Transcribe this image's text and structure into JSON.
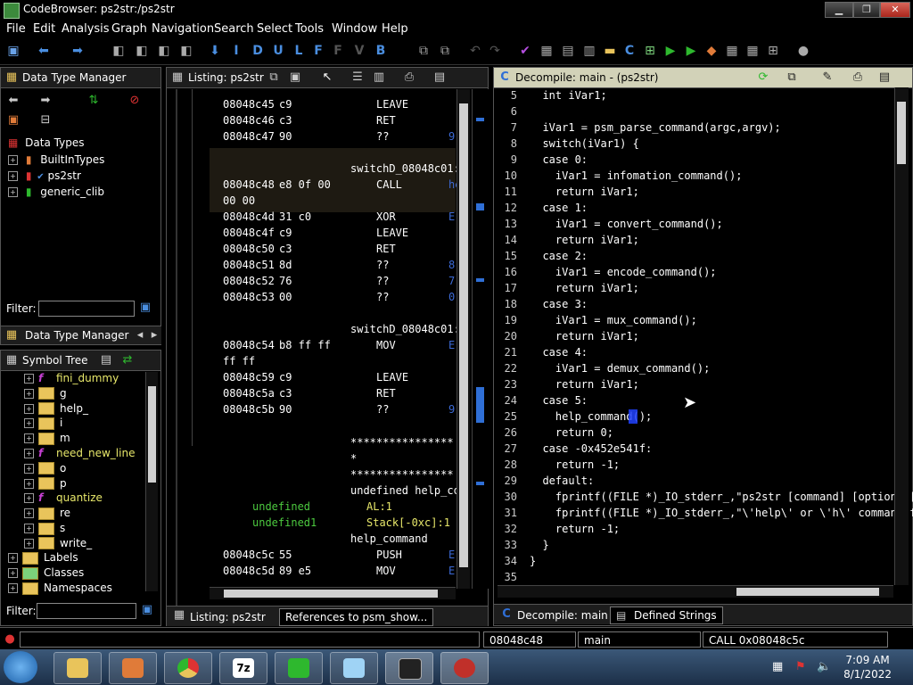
{
  "window": {
    "title": "CodeBrowser: ps2str:/ps2str"
  },
  "menu": [
    "File",
    "Edit",
    "Analysis",
    "Graph",
    "Navigation",
    "Search",
    "Select",
    "Tools",
    "Window",
    "Help"
  ],
  "data_type_manager": {
    "title": "Data Type Manager",
    "root": "Data Types",
    "items": [
      "BuiltInTypes",
      "ps2str",
      "generic_clib"
    ],
    "filter_label": "Filter:",
    "tab": "Data Type Manager"
  },
  "symbol_tree": {
    "title": "Symbol Tree",
    "items": [
      {
        "label": "fini_dummy",
        "kind": "function"
      },
      {
        "label": "g",
        "kind": "folder"
      },
      {
        "label": "help_",
        "kind": "folder"
      },
      {
        "label": "i",
        "kind": "folder"
      },
      {
        "label": "m",
        "kind": "folder"
      },
      {
        "label": "need_new_line",
        "kind": "function"
      },
      {
        "label": "o",
        "kind": "folder"
      },
      {
        "label": "p",
        "kind": "folder"
      },
      {
        "label": "quantize",
        "kind": "function"
      },
      {
        "label": "re",
        "kind": "folder"
      },
      {
        "label": "s",
        "kind": "folder"
      },
      {
        "label": "write_",
        "kind": "folder"
      }
    ],
    "roots": [
      "Labels",
      "Classes",
      "Namespaces"
    ],
    "filter_label": "Filter:"
  },
  "listing": {
    "title": "Listing:  ps2str",
    "lines": [
      {
        "addr": "08048c45",
        "bytes": "c9",
        "mnem": "LEAVE",
        "op": ""
      },
      {
        "addr": "08048c46",
        "bytes": "c3",
        "mnem": "RET",
        "op": ""
      },
      {
        "addr": "08048c47",
        "bytes": "90",
        "mnem": "??",
        "op": "9"
      },
      {
        "label": "switchD_08048c01:"
      },
      {
        "addr": "08048c48",
        "bytes": "e8 0f 00",
        "mnem": "CALL",
        "op": "he"
      },
      {
        "cont": "00 00"
      },
      {
        "addr": "08048c4d",
        "bytes": "31 c0",
        "mnem": "XOR",
        "op": "E"
      },
      {
        "addr": "08048c4f",
        "bytes": "c9",
        "mnem": "LEAVE",
        "op": ""
      },
      {
        "addr": "08048c50",
        "bytes": "c3",
        "mnem": "RET",
        "op": ""
      },
      {
        "addr": "08048c51",
        "bytes": "8d",
        "mnem": "??",
        "op": "8"
      },
      {
        "addr": "08048c52",
        "bytes": "76",
        "mnem": "??",
        "op": "7"
      },
      {
        "addr": "08048c53",
        "bytes": "00",
        "mnem": "??",
        "op": "0"
      },
      {
        "label": "switchD_08048c01:"
      },
      {
        "addr": "08048c54",
        "bytes": "b8 ff ff",
        "mnem": "MOV",
        "op": "E"
      },
      {
        "cont": "ff ff"
      },
      {
        "addr": "08048c59",
        "bytes": "c9",
        "mnem": "LEAVE",
        "op": ""
      },
      {
        "addr": "08048c5a",
        "bytes": "c3",
        "mnem": "RET",
        "op": ""
      },
      {
        "addr": "08048c5b",
        "bytes": "90",
        "mnem": "??",
        "op": "9"
      }
    ],
    "stars1": "****************",
    "stars2": "*",
    "stars3": "****************",
    "fn_sig": "undefined help_co",
    "param1_type": "undefined",
    "param1_loc": "AL:1",
    "param2_type": "undefined1",
    "param2_loc": "Stack[-0xc]:1",
    "fn_label": "help_command",
    "lines2": [
      {
        "addr": "08048c5c",
        "bytes": "55",
        "mnem": "PUSH",
        "op": "E"
      },
      {
        "addr": "08048c5d",
        "bytes": "89 e5",
        "mnem": "MOV",
        "op": "E"
      }
    ],
    "tabs": [
      "Listing:  ps2str",
      "References to psm_show..."
    ]
  },
  "decompile": {
    "title": "Decompile: main -  (ps2str)",
    "lines": [
      {
        "n": "5",
        "t": "  int iVar1;"
      },
      {
        "n": "6",
        "t": ""
      },
      {
        "n": "7",
        "t": "  iVar1 = psm_parse_command(argc,argv);"
      },
      {
        "n": "8",
        "t": "  switch(iVar1) {"
      },
      {
        "n": "9",
        "t": "  case 0:"
      },
      {
        "n": "10",
        "t": "    iVar1 = infomation_command();"
      },
      {
        "n": "11",
        "t": "    return iVar1;"
      },
      {
        "n": "12",
        "t": "  case 1:"
      },
      {
        "n": "13",
        "t": "    iVar1 = convert_command();"
      },
      {
        "n": "14",
        "t": "    return iVar1;"
      },
      {
        "n": "15",
        "t": "  case 2:"
      },
      {
        "n": "16",
        "t": "    iVar1 = encode_command();"
      },
      {
        "n": "17",
        "t": "    return iVar1;"
      },
      {
        "n": "18",
        "t": "  case 3:"
      },
      {
        "n": "19",
        "t": "    iVar1 = mux_command();"
      },
      {
        "n": "20",
        "t": "    return iVar1;"
      },
      {
        "n": "21",
        "t": "  case 4:"
      },
      {
        "n": "22",
        "t": "    iVar1 = demux_command();"
      },
      {
        "n": "23",
        "t": "    return iVar1;"
      },
      {
        "n": "24",
        "t": "  case 5:"
      },
      {
        "n": "25",
        "t": "    help_command();"
      },
      {
        "n": "26",
        "t": "    return 0;"
      },
      {
        "n": "27",
        "t": "  case -0x452e541f:"
      },
      {
        "n": "28",
        "t": "    return -1;"
      },
      {
        "n": "29",
        "t": "  default:"
      },
      {
        "n": "30",
        "t": "    fprintf((FILE *)_IO_stderr_,\"ps2str [command] [option] ["
      },
      {
        "n": "31",
        "t": "    fprintf((FILE *)_IO_stderr_,\"\\'help\\' or \\'h\\' command f"
      },
      {
        "n": "32",
        "t": "    return -1;"
      },
      {
        "n": "33",
        "t": "  }"
      },
      {
        "n": "34",
        "t": "}"
      },
      {
        "n": "35",
        "t": ""
      }
    ],
    "tabs": [
      "Decompile: main",
      "Defined Strings"
    ]
  },
  "status": {
    "address": "08048c48",
    "function": "main",
    "instruction": "CALL 0x08048c5c"
  },
  "clock": {
    "time": "7:09 AM",
    "date": "8/1/2022"
  }
}
